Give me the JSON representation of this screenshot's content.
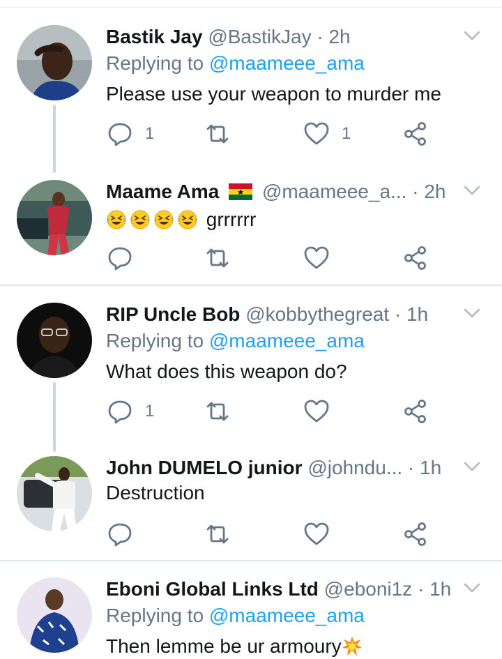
{
  "replying_to_label": "Replying to",
  "colors": {
    "link": "#1da1f2",
    "muted": "#657786",
    "text": "#14171a",
    "divider": "#e1e8ed",
    "thread": "#ccd6dd"
  },
  "tweets": [
    {
      "name": "Bastik Jay",
      "handle": "@BastikJay",
      "dot": " · ",
      "time": "2h",
      "replying_to": "@maameee_ama",
      "text": "Please use your weapon to murder me",
      "reply_count": "1",
      "retweet_count": "",
      "like_count": "1",
      "avatar": "person-grey-background"
    },
    {
      "name": "Maame Ama",
      "flag": "ghana-flag",
      "handle": "@maameee_a...",
      "dot": " · ",
      "time": "2h",
      "emojis": [
        "rolling-on-floor-laughing",
        "rolling-on-floor-laughing",
        "rolling-on-floor-laughing",
        "rolling-on-floor-laughing"
      ],
      "text": "grrrrrr",
      "reply_count": "",
      "retweet_count": "",
      "like_count": "",
      "avatar": "woman-red-dress-cars"
    },
    {
      "name": "RIP Uncle Bob",
      "handle": "@kobbythegreat",
      "dot": " · ",
      "time": "1h",
      "replying_to": "@maameee_ama",
      "text": "What does this weapon do?",
      "reply_count": "1",
      "retweet_count": "",
      "like_count": "",
      "avatar": "man-glasses-dark-background"
    },
    {
      "name": "John DUMELO junior",
      "handle": "@johndu...",
      "dot": " · ",
      "time": "1h",
      "text": "Destruction",
      "reply_count": "",
      "retweet_count": "",
      "like_count": "",
      "avatar": "man-white-outfit-car"
    },
    {
      "name": "Eboni Global Links Ltd",
      "handle": "@eboni1z",
      "dot": " · ",
      "time": "1h",
      "replying_to": "@maameee_ama",
      "text": "Then lemme be ur armoury",
      "trailing_emoji": "collision",
      "avatar": "man-patterned-shirt"
    }
  ]
}
